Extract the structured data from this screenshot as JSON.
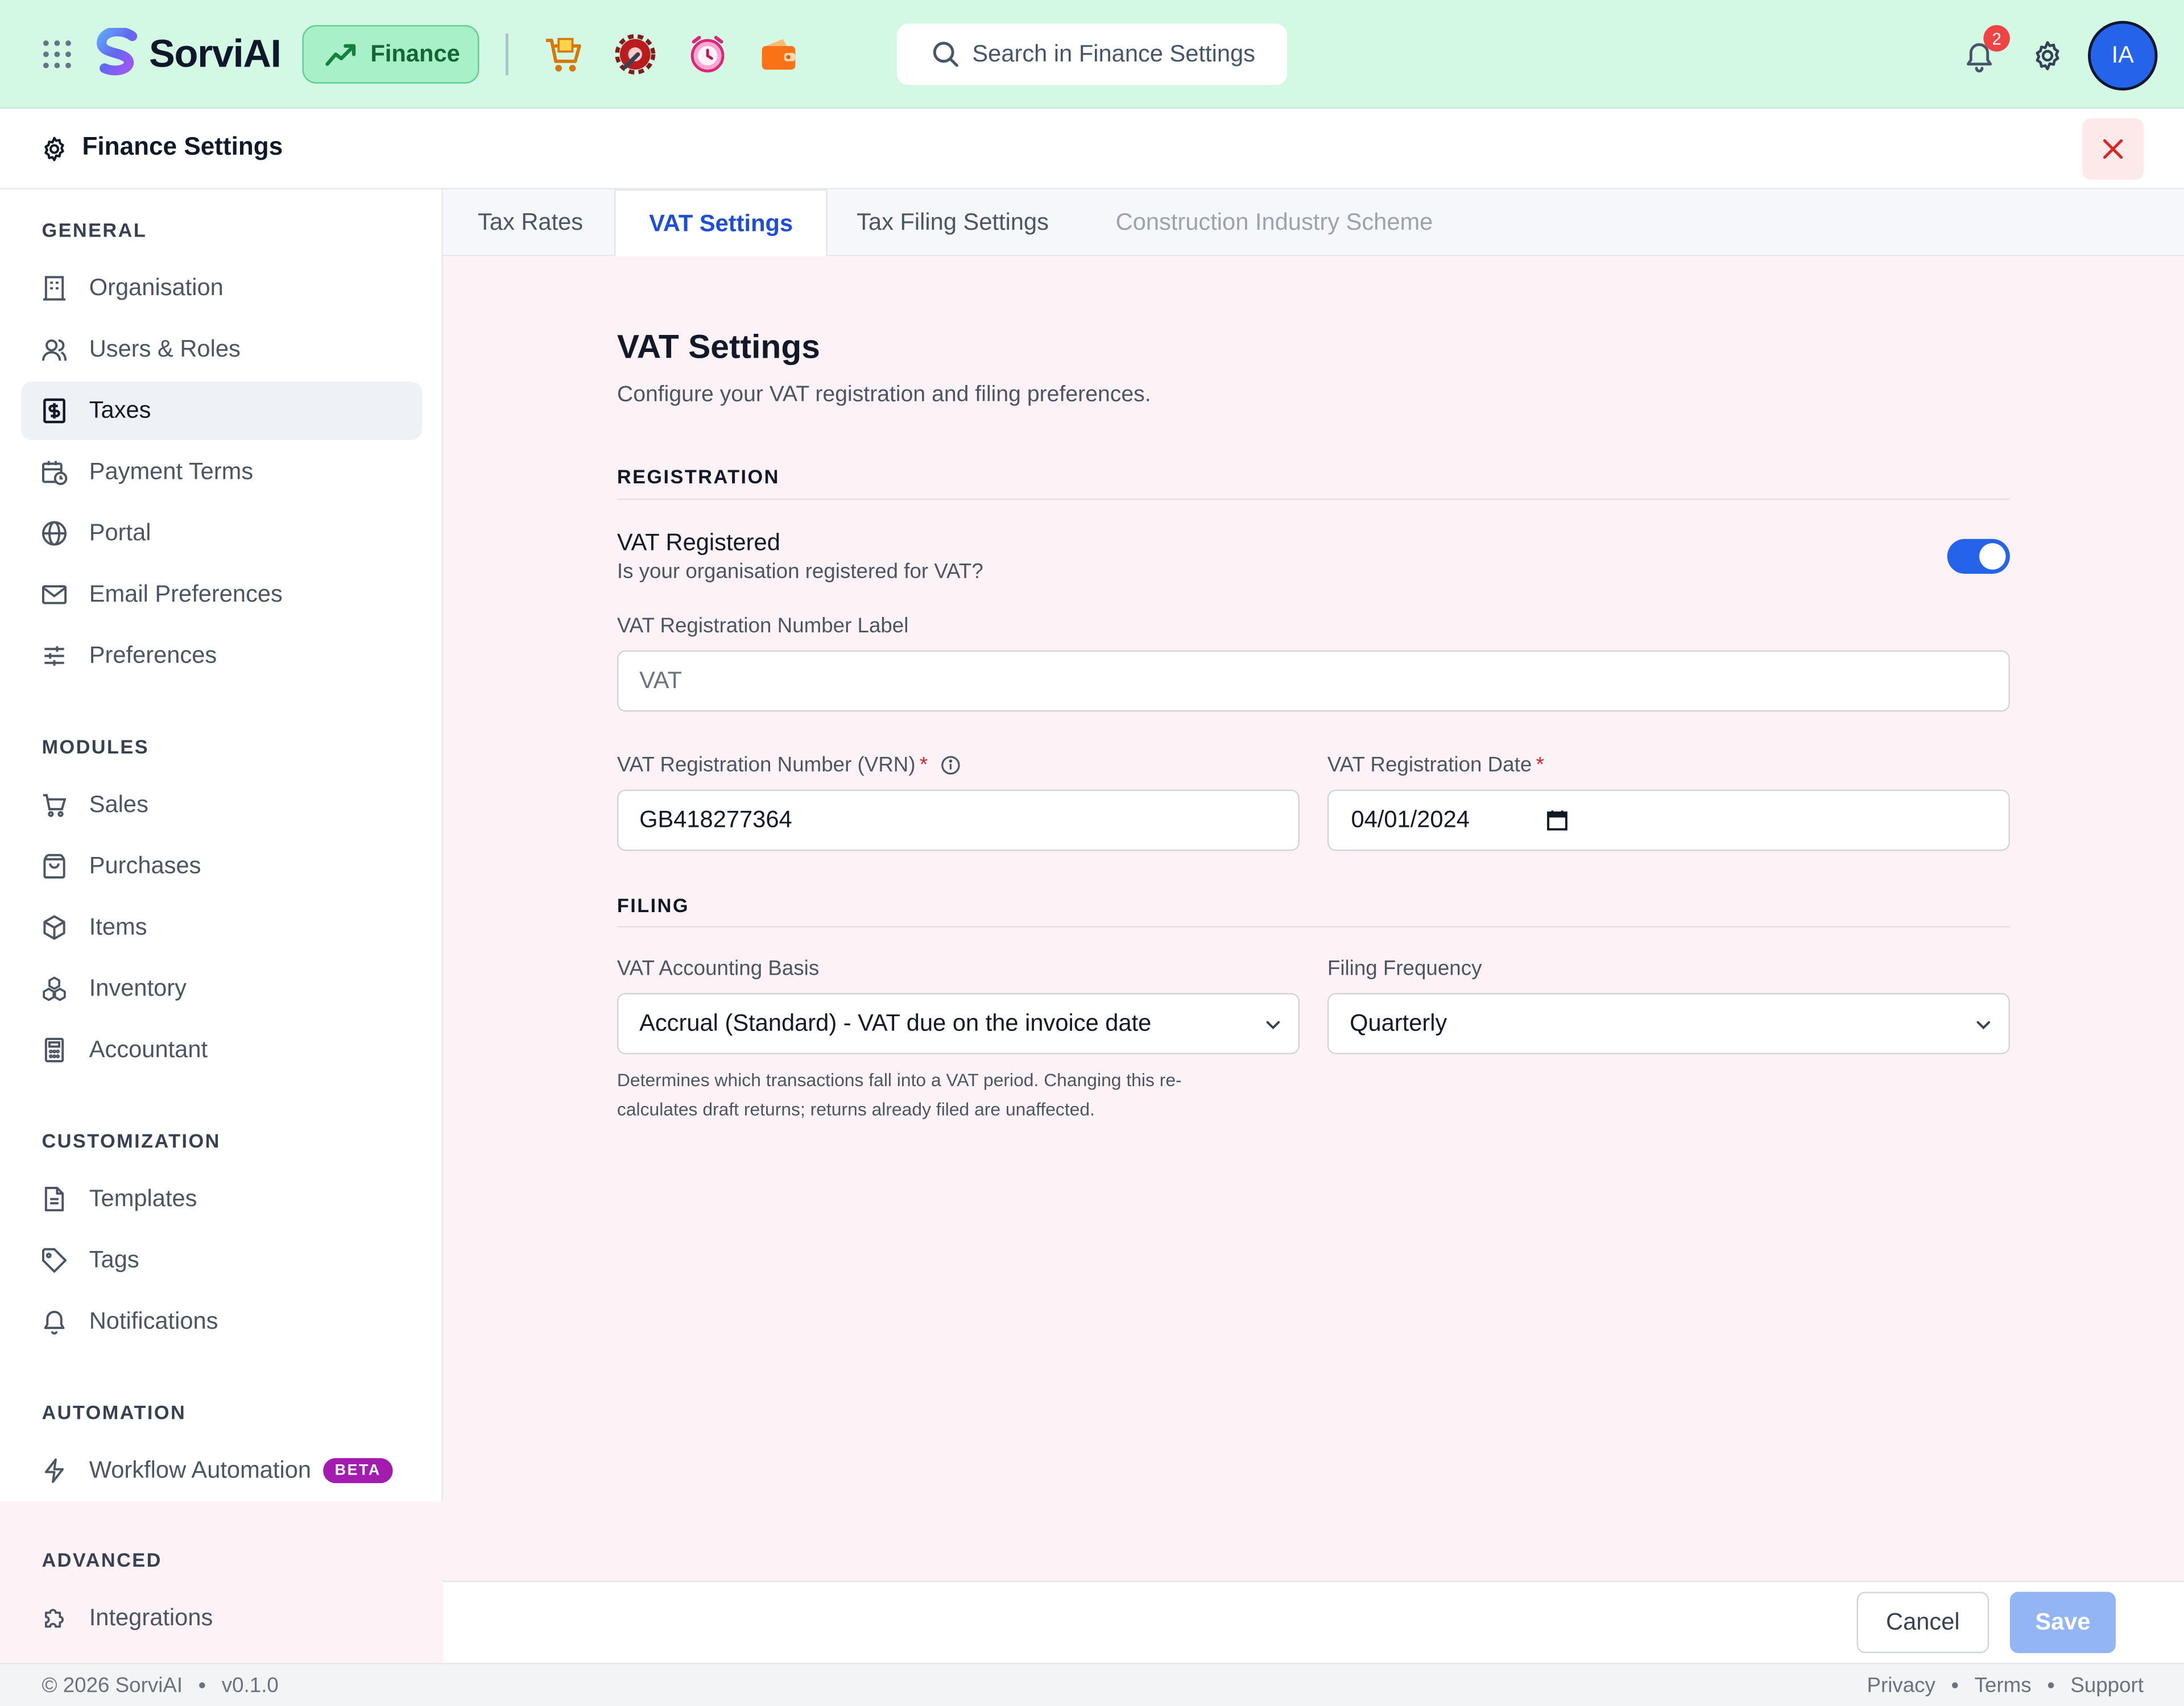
{
  "app": {
    "name": "SorviAI",
    "module": "Finance"
  },
  "header": {
    "search_placeholder": "Search in Finance Settings",
    "notification_count": "2",
    "avatar_initials": "IA",
    "app_icons": [
      "cart-icon",
      "gear-wrench-icon",
      "alarm-clock-icon",
      "wallet-icon"
    ]
  },
  "page": {
    "title": "Finance Settings"
  },
  "sidebar": {
    "general_title": "GENERAL",
    "general": [
      {
        "label": "Organisation",
        "icon": "building-icon"
      },
      {
        "label": "Users & Roles",
        "icon": "users-icon"
      },
      {
        "label": "Taxes",
        "icon": "dollar-receipt-icon",
        "active": true
      },
      {
        "label": "Payment Terms",
        "icon": "calendar-clock-icon"
      },
      {
        "label": "Portal",
        "icon": "globe-icon"
      },
      {
        "label": "Email Preferences",
        "icon": "mail-icon"
      },
      {
        "label": "Preferences",
        "icon": "sliders-icon"
      }
    ],
    "modules_title": "MODULES",
    "modules": [
      {
        "label": "Sales",
        "icon": "cart-icon"
      },
      {
        "label": "Purchases",
        "icon": "bag-icon"
      },
      {
        "label": "Items",
        "icon": "box-icon"
      },
      {
        "label": "Inventory",
        "icon": "boxes-icon"
      },
      {
        "label": "Accountant",
        "icon": "calculator-icon"
      }
    ],
    "customization_title": "CUSTOMIZATION",
    "customization": [
      {
        "label": "Templates",
        "icon": "file-icon"
      },
      {
        "label": "Tags",
        "icon": "tag-icon"
      },
      {
        "label": "Notifications",
        "icon": "bell-icon"
      }
    ],
    "automation_title": "AUTOMATION",
    "automation": [
      {
        "label": "Workflow Automation",
        "icon": "lightning-icon",
        "badge": "BETA"
      }
    ],
    "advanced_title": "ADVANCED",
    "advanced": [
      {
        "label": "Integrations",
        "icon": "puzzle-icon"
      }
    ]
  },
  "tabs": [
    {
      "label": "Tax Rates"
    },
    {
      "label": "VAT Settings",
      "active": true
    },
    {
      "label": "Tax Filing Settings"
    },
    {
      "label": "Construction Industry Scheme",
      "disabled": true
    }
  ],
  "vat": {
    "title": "VAT Settings",
    "subtitle": "Configure your VAT registration and filing preferences.",
    "registration_title": "REGISTRATION",
    "vat_registered_label": "VAT Registered",
    "vat_registered_help": "Is your organisation registered for VAT?",
    "vat_registered": true,
    "vrn_label_label": "VAT Registration Number Label",
    "vrn_label_value": "VAT",
    "vrn_label": "VAT Registration Number (VRN)",
    "vrn_value": "GB418277364",
    "date_label": "VAT Registration Date",
    "date_value": "04/01/2024",
    "filing_title": "FILING",
    "basis_label": "VAT Accounting Basis",
    "basis_value": "Accrual (Standard) - VAT due on the invoice date",
    "basis_help_1": "Determines which transactions fall into a VAT period. Changing this re-",
    "basis_help_2": "calculates draft returns; returns already filed are unaffected.",
    "frequency_label": "Filing Frequency",
    "frequency_value": "Quarterly"
  },
  "actions": {
    "cancel": "Cancel",
    "save": "Save"
  },
  "footer": {
    "copyright": "© 2026 SorviAI",
    "version": "v0.1.0",
    "links": [
      "Privacy",
      "Terms",
      "Support"
    ]
  },
  "colors": {
    "accent": "#2563eb",
    "topbar": "#d3f8e4",
    "content_bg": "#fdf2f5",
    "required": "#dc2626"
  }
}
